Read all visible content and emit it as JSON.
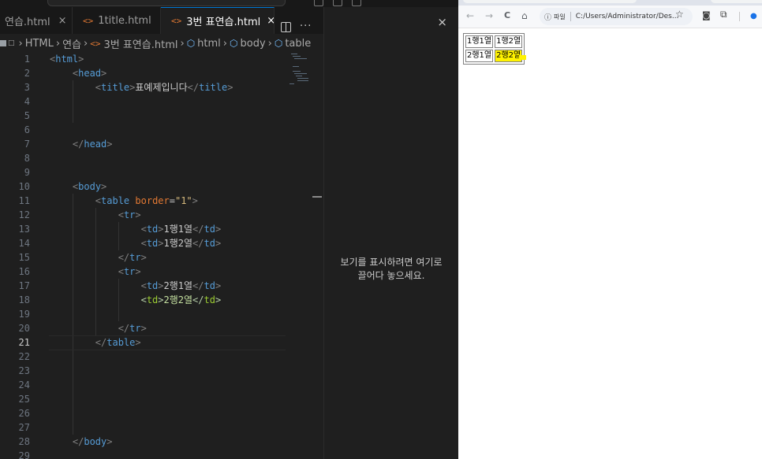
{
  "vscode": {
    "tabs": [
      {
        "label": "연습.html",
        "has_icon": false,
        "active": false
      },
      {
        "label": "1title.html",
        "has_icon": true,
        "active": false
      },
      {
        "label": "3번 표연습.html",
        "has_icon": true,
        "active": true
      }
    ],
    "tab_close_glyph": "×",
    "more_glyph": "···",
    "breadcrumb": [
      "HTML",
      "연습",
      "3번 표연습.html",
      "html",
      "body",
      "table"
    ],
    "code_lines": [
      {
        "n": "1",
        "tokens": [
          [
            "tg",
            "<"
          ],
          [
            "tn",
            "html"
          ],
          [
            "tg",
            ">"
          ]
        ]
      },
      {
        "n": "2",
        "tokens": [
          [
            "sp",
            "    "
          ],
          [
            "tg",
            "<"
          ],
          [
            "tn",
            "head"
          ],
          [
            "tg",
            ">"
          ]
        ]
      },
      {
        "n": "3",
        "tokens": [
          [
            "sp",
            "        "
          ],
          [
            "tg",
            "<"
          ],
          [
            "tn",
            "title"
          ],
          [
            "tg",
            ">"
          ],
          [
            "tx",
            "표예제입니다"
          ],
          [
            "tg",
            "</"
          ],
          [
            "tn",
            "title"
          ],
          [
            "tg",
            ">"
          ]
        ]
      },
      {
        "n": "4",
        "tokens": []
      },
      {
        "n": "5",
        "tokens": []
      },
      {
        "n": "6",
        "tokens": []
      },
      {
        "n": "7",
        "tokens": [
          [
            "sp",
            "    "
          ],
          [
            "tg",
            "</"
          ],
          [
            "tn",
            "head"
          ],
          [
            "tg",
            ">"
          ]
        ]
      },
      {
        "n": "8",
        "tokens": []
      },
      {
        "n": "9",
        "tokens": []
      },
      {
        "n": "10",
        "tokens": [
          [
            "sp",
            "    "
          ],
          [
            "tg",
            "<"
          ],
          [
            "tn",
            "body"
          ],
          [
            "tg",
            ">"
          ]
        ]
      },
      {
        "n": "11",
        "tokens": [
          [
            "sp",
            "        "
          ],
          [
            "tg",
            "<"
          ],
          [
            "tn",
            "table"
          ],
          [
            "sp",
            " "
          ],
          [
            "an",
            "border"
          ],
          [
            "tx",
            "="
          ],
          [
            "av",
            "\"1\""
          ],
          [
            "tg",
            ">"
          ]
        ]
      },
      {
        "n": "12",
        "tokens": [
          [
            "sp",
            "            "
          ],
          [
            "tg",
            "<"
          ],
          [
            "tn",
            "tr"
          ],
          [
            "tg",
            ">"
          ]
        ]
      },
      {
        "n": "13",
        "tokens": [
          [
            "sp",
            "                "
          ],
          [
            "tg",
            "<"
          ],
          [
            "tn",
            "td"
          ],
          [
            "tg",
            ">"
          ],
          [
            "tx",
            "1행1열"
          ],
          [
            "tg",
            "</"
          ],
          [
            "tn",
            "td"
          ],
          [
            "tg",
            ">"
          ]
        ]
      },
      {
        "n": "14",
        "tokens": [
          [
            "sp",
            "                "
          ],
          [
            "tg",
            "<"
          ],
          [
            "tn",
            "td"
          ],
          [
            "tg",
            ">"
          ],
          [
            "tx",
            "1행2열"
          ],
          [
            "tg",
            "</"
          ],
          [
            "tn",
            "td"
          ],
          [
            "tg",
            ">"
          ]
        ]
      },
      {
        "n": "15",
        "tokens": [
          [
            "sp",
            "            "
          ],
          [
            "tg",
            "</"
          ],
          [
            "tn",
            "tr"
          ],
          [
            "tg",
            ">"
          ]
        ]
      },
      {
        "n": "16",
        "tokens": [
          [
            "sp",
            "            "
          ],
          [
            "tg",
            "<"
          ],
          [
            "tn",
            "tr"
          ],
          [
            "tg",
            ">"
          ]
        ]
      },
      {
        "n": "17",
        "tokens": [
          [
            "sp",
            "                "
          ],
          [
            "tg",
            "<"
          ],
          [
            "tn",
            "td"
          ],
          [
            "tg",
            ">"
          ],
          [
            "tx",
            "2행1열"
          ],
          [
            "tg",
            "</"
          ],
          [
            "tn",
            "td"
          ],
          [
            "tg",
            ">"
          ]
        ]
      },
      {
        "n": "18",
        "tokens": [
          [
            "sp",
            "                "
          ],
          [
            "tg-y",
            "<"
          ],
          [
            "tn-y",
            "td"
          ],
          [
            "tg-y",
            ">"
          ],
          [
            "tx-y",
            "2행2열"
          ],
          [
            "tg-y",
            "</"
          ],
          [
            "tn-y",
            "td"
          ],
          [
            "tg-y",
            ">"
          ]
        ]
      },
      {
        "n": "19",
        "tokens": []
      },
      {
        "n": "20",
        "tokens": [
          [
            "sp",
            "            "
          ],
          [
            "tg",
            "</"
          ],
          [
            "tn",
            "tr"
          ],
          [
            "tg",
            ">"
          ]
        ]
      },
      {
        "n": "21",
        "tokens": [
          [
            "sp",
            "        "
          ],
          [
            "tg",
            "</"
          ],
          [
            "tn",
            "table"
          ],
          [
            "tg",
            ">"
          ]
        ],
        "current": true
      },
      {
        "n": "22",
        "tokens": []
      },
      {
        "n": "23",
        "tokens": []
      },
      {
        "n": "24",
        "tokens": []
      },
      {
        "n": "25",
        "tokens": []
      },
      {
        "n": "26",
        "tokens": []
      },
      {
        "n": "27",
        "tokens": []
      },
      {
        "n": "28",
        "tokens": [
          [
            "sp",
            "    "
          ],
          [
            "tg",
            "</"
          ],
          [
            "tn",
            "body"
          ],
          [
            "tg",
            ">"
          ]
        ]
      },
      {
        "n": "29",
        "tokens": []
      }
    ],
    "preview": {
      "close_glyph": "×",
      "hint_line1": "보기를 표시하려면 여기로",
      "hint_line2": "끌어다 놓으세요."
    }
  },
  "browser": {
    "back_glyph": "←",
    "forward_glyph": "→",
    "reload_glyph": "C",
    "home_glyph": "⌂",
    "scheme_label": "파일",
    "url": "C:/Users/Administrator/Des...",
    "star_glyph": "☆",
    "table": [
      [
        "1행1열",
        "1행2열"
      ],
      [
        "2행1열",
        "2행2열"
      ]
    ],
    "highlight_color": "#fff200"
  },
  "colors": {
    "accent": "#0078d4",
    "html_icon": "#e37933",
    "tag": "#569cd6"
  }
}
